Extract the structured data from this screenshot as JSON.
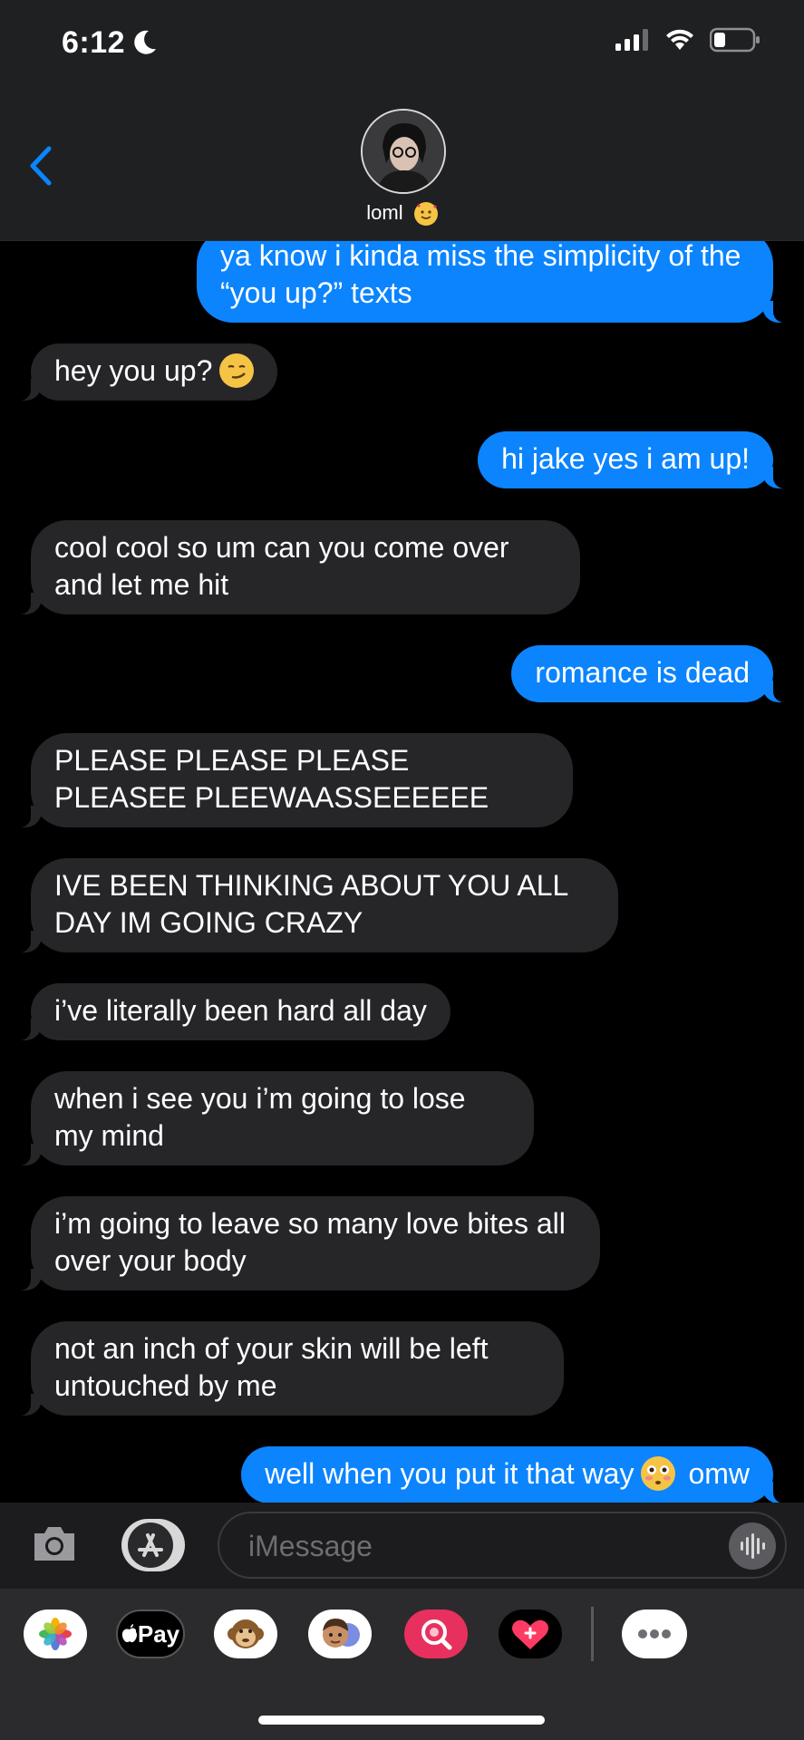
{
  "status_bar": {
    "time": "6:12"
  },
  "contact": {
    "name": "loml",
    "emoji": "smiling-face-with-hearts"
  },
  "messages": [
    {
      "from": "me",
      "text": "ya know i kinda miss the simplicity of the “you up?” texts"
    },
    {
      "from": "them",
      "text": "hey you up?",
      "emoji": "smirking-face"
    },
    {
      "from": "me",
      "text": "hi jake yes i am up!"
    },
    {
      "from": "them",
      "text": "cool cool so um can you come over and let me hit"
    },
    {
      "from": "me",
      "text": "romance is dead"
    },
    {
      "from": "them",
      "text": "PLEASE PLEASE PLEASE PLEASEE PLEEWAASSEEEEEE"
    },
    {
      "from": "them",
      "text": "IVE BEEN THINKING ABOUT YOU ALL DAY IM GOING CRAZY"
    },
    {
      "from": "them",
      "text": "i’ve literally been hard all day"
    },
    {
      "from": "them",
      "text": "when i see you i’m going to lose my mind"
    },
    {
      "from": "them",
      "text": "i’m going to leave so many love bites all over your body"
    },
    {
      "from": "them",
      "text": "not an inch of your skin will be left untouched by me"
    },
    {
      "from": "me",
      "text": "well when you put it that way",
      "emoji": "flushed-face",
      "text_after": "omw"
    }
  ],
  "input": {
    "placeholder": "iMessage"
  },
  "app_drawer": {
    "apple_pay_label": "Pay",
    "items": [
      "photos-icon",
      "apple-pay-icon",
      "animoji-icon",
      "memoji-icon",
      "image-search-icon",
      "digital-touch-icon",
      "more-icon"
    ]
  },
  "colors": {
    "outgoing": "#0b84fe",
    "incoming": "#262629",
    "accent": "#0a84ff"
  }
}
